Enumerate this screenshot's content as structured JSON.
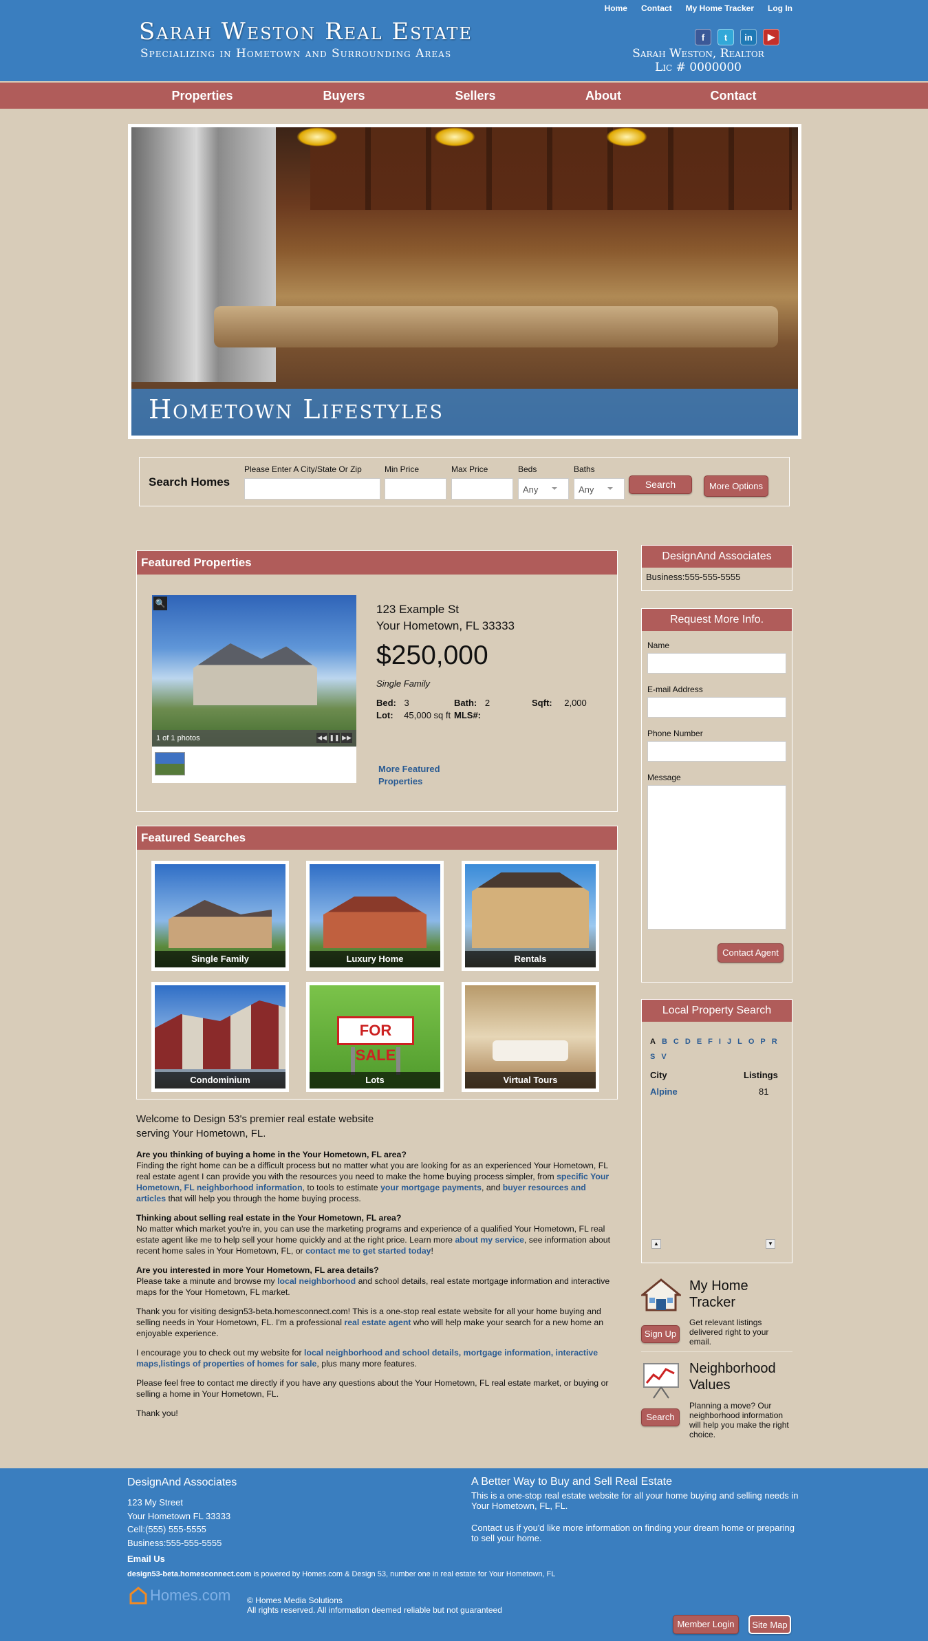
{
  "header": {
    "title": "Sarah Weston Real Estate",
    "tagline": "Specializing in Hometown and Surrounding Areas",
    "top_links": [
      "Home",
      "Contact",
      "My Home Tracker",
      "Log In"
    ],
    "social_icons": [
      "facebook-icon",
      "twitter-icon",
      "linkedin-icon",
      "youtube-icon"
    ],
    "realtor_name": "Sarah Weston, Realtor",
    "license": "Lic # 0000000"
  },
  "nav": {
    "items": [
      "Properties",
      "Buyers",
      "Sellers",
      "About",
      "Contact"
    ]
  },
  "hero": {
    "caption": "Hometown Lifestyles"
  },
  "search": {
    "title": "Search Homes",
    "location_label": "Please Enter A City/State Or Zip",
    "min_price_label": "Min Price",
    "max_price_label": "Max Price",
    "beds_label": "Beds",
    "beds_value": "Any",
    "baths_label": "Baths",
    "baths_value": "Any",
    "search_button": "Search",
    "more_options_button": "More Options"
  },
  "featured_properties": {
    "heading": "Featured Properties",
    "photo_counter": "1 of 1 photos",
    "address_line1": "123 Example St",
    "address_line2": "Your Hometown, FL 33333",
    "price": "$250,000",
    "type": "Single Family",
    "bed_label": "Bed:",
    "bed_value": "3",
    "bath_label": "Bath:",
    "bath_value": "2",
    "sqft_label": "Sqft:",
    "sqft_value": "2,000",
    "lot_label": "Lot:",
    "lot_value": "45,000 sq ft",
    "mls_label": "MLS#:",
    "more_link_line1": "More Featured",
    "more_link_line2": "Properties"
  },
  "featured_searches": {
    "heading": "Featured Searches",
    "tiles": [
      "Single Family",
      "Luxury Home",
      "Rentals",
      "Condominium",
      "Lots",
      "Virtual Tours"
    ],
    "for_sale_sign": "FOR SALE"
  },
  "article": {
    "intro": "Welcome to Design 53's premier real estate website serving Your Hometown, FL.",
    "q1": "Are you thinking of buying a home in the Your Hometown, FL area?",
    "p1a": "Finding the right home can be a difficult process but no matter what you are looking for as an experienced Your Hometown, FL real estate agent I can provide you with the resources you need to make the home buying process simpler, from ",
    "p1_link1": "specific Your Hometown, FL neighborhood information",
    "p1b": ", to tools to estimate ",
    "p1_link2": "your mortgage payments",
    "p1c": ", and ",
    "p1_link3": "buyer resources and articles ",
    "p1d": "that will help you through the home buying process.",
    "q2": "Thinking about selling real estate in the Your Hometown, FL area?",
    "p2a": "No matter which market you're in, you can use the marketing programs and experience of a qualified Your Hometown, FL real estate agent like me to help sell your home quickly and at the right price. Learn more ",
    "p2_link1": "about my service",
    "p2b": ", see information about recent home sales in Your Hometown, FL, or ",
    "p2_link2": "contact me to get started today",
    "p2c": "!",
    "q3": "Are you interested in more Your Hometown, FL area details?",
    "p3a": "Please take a minute and browse my ",
    "p3_link1": "local neighborhood",
    "p3b": " and school details, real estate mortgage information and interactive maps for the Your Hometown, FL market.",
    "p4a": "Thank you for visiting design53-beta.homesconnect.com! This is a one-stop real estate website for all your home buying and selling needs in Your Hometown, FL. I'm a professional ",
    "p4_link1": "real estate agent",
    "p4b": " who will help make your search for a new home an enjoyable experience.",
    "p5a": "I encourage you to check out my website for ",
    "p5_link1": "local neighborhood and school details, mortgage information, interactive maps,listings of properties of homes for sale",
    "p5b": ", plus many more features.",
    "p6": "Please feel free to contact me directly if you have any questions about the Your Hometown, FL real estate market, or buying or selling a home in Your Hometown, FL.",
    "p7": "Thank you!"
  },
  "sidebar": {
    "company": {
      "heading": "DesignAnd Associates",
      "phone": "Business:555-555-5555"
    },
    "request": {
      "heading": "Request More Info.",
      "name_label": "Name",
      "email_label": "E-mail Address",
      "phone_label": "Phone Number",
      "message_label": "Message",
      "button": "Contact Agent"
    },
    "local_search": {
      "heading": "Local Property Search",
      "letters": [
        "A",
        "B",
        "C",
        "D",
        "E",
        "F",
        "I",
        "J",
        "L",
        "O",
        "P",
        "R",
        "S",
        "V"
      ],
      "col_city": "City",
      "col_listings": "Listings",
      "city": "Alpine",
      "count": "81"
    },
    "tracker": {
      "title_line1": "My Home",
      "title_line2": "Tracker",
      "button": "Sign Up",
      "desc": "Get relevant listings delivered right to your email."
    },
    "values": {
      "title_line1": "Neighborhood",
      "title_line2": "Values",
      "button": "Search",
      "desc": "Planning a move? Our neighborhood information will help you make the right choice."
    }
  },
  "footer": {
    "company": "DesignAnd Associates",
    "street": "123 My Street",
    "city": "Your Hometown FL 33333",
    "cell": "Cell:(555) 555-5555",
    "business": "Business:555-555-5555",
    "email": "Email Us",
    "powered_site": "design53-beta.homesconnect.com",
    "powered_rest": " is powered by Homes.com & Design 53, number one in real estate for Your Hometown, FL",
    "logo_text": "Homes.com",
    "copyright": "© Homes Media Solutions",
    "rights": "All rights reserved. All information deemed reliable but not guaranteed",
    "right_heading": "A Better Way to Buy and Sell Real Estate",
    "right_p1": "This is a one-stop real estate website for all your home buying and selling needs in Your Hometown, FL, FL.",
    "right_p2": "Contact us if you'd like more information on finding your dream home or preparing to sell your home.",
    "member_login": "Member Login",
    "site_map": "Site Map"
  },
  "colors": {
    "brand_blue": "#3a7ebf",
    "accent_red": "#b05c5a",
    "background": "#d8ccb9"
  }
}
